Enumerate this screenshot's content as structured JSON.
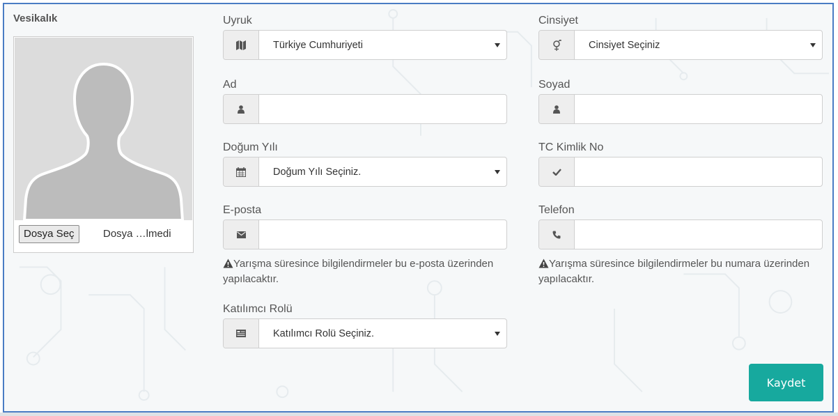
{
  "photo": {
    "label": "Vesikalık",
    "choose_file_button": "Dosya Seç",
    "file_status": "Dosya …lmedi"
  },
  "fields": {
    "nationality": {
      "label": "Uyruk",
      "selected": "Türkiye Cumhuriyeti",
      "icon": "map-icon"
    },
    "gender": {
      "label": "Cinsiyet",
      "selected": "Cinsiyet Seçiniz",
      "icon": "gender-icon"
    },
    "first_name": {
      "label": "Ad",
      "value": "",
      "icon": "user-icon"
    },
    "last_name": {
      "label": "Soyad",
      "value": "",
      "icon": "user-icon"
    },
    "birth_year": {
      "label": "Doğum Yılı",
      "selected": "Doğum Yılı Seçiniz.",
      "icon": "calendar-icon"
    },
    "tc_no": {
      "label": "TC Kimlik No",
      "value": "",
      "icon": "check-icon"
    },
    "email": {
      "label": "E-posta",
      "value": "",
      "icon": "envelope-icon",
      "help": "Yarışma süresince bilgilendirmeler bu e-posta üzerinden yapılacaktır.",
      "help_icon": "warning-icon"
    },
    "phone": {
      "label": "Telefon",
      "value": "",
      "icon": "phone-icon",
      "help": "Yarışma süresince bilgilendirmeler bu numara üzerinden yapılacaktır.",
      "help_icon": "warning-icon"
    },
    "role": {
      "label": "Katılımcı Rolü",
      "selected": "Katılımcı Rolü Seçiniz.",
      "icon": "id-card-icon"
    }
  },
  "save_button": "Kaydet",
  "colors": {
    "accent": "#17a99e",
    "frame_border": "#4a7cc4",
    "addon_bg": "#eeeeee"
  }
}
